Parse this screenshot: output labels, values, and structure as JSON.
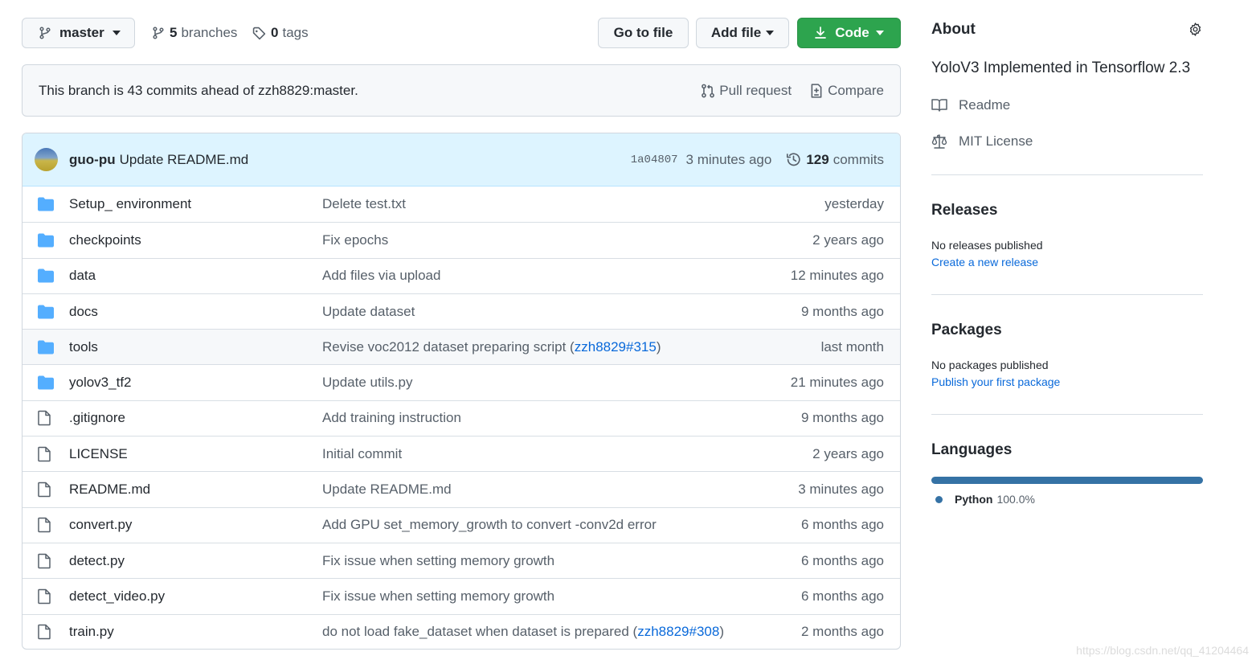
{
  "toolbar": {
    "branch_name": "master",
    "branches_count": "5",
    "branches_label": "branches",
    "tags_count": "0",
    "tags_label": "tags",
    "goto_file_label": "Go to file",
    "add_file_label": "Add file",
    "code_label": "Code"
  },
  "ahead_banner": {
    "text": "This branch is 43 commits ahead of zzh8829:master.",
    "pull_request_label": "Pull request",
    "compare_label": "Compare"
  },
  "latest_commit": {
    "author": "guo-pu",
    "message": "Update README.md",
    "sha": "1a04807",
    "time": "3 minutes ago",
    "commits_count": "129",
    "commits_label": "commits"
  },
  "files": [
    {
      "type": "folder",
      "name": "Setup_ environment",
      "message": "Delete test.txt",
      "ref": "",
      "ref_suffix": "",
      "age": "yesterday"
    },
    {
      "type": "folder",
      "name": "checkpoints",
      "message": "Fix epochs",
      "ref": "",
      "ref_suffix": "",
      "age": "2 years ago"
    },
    {
      "type": "folder",
      "name": "data",
      "message": "Add files via upload",
      "ref": "",
      "ref_suffix": "",
      "age": "12 minutes ago"
    },
    {
      "type": "folder",
      "name": "docs",
      "message": "Update dataset",
      "ref": "",
      "ref_suffix": "",
      "age": "9 months ago"
    },
    {
      "type": "folder",
      "name": "tools",
      "message": "Revise voc2012 dataset preparing script (",
      "ref": "zzh8829#315",
      "ref_suffix": ")",
      "age": "last month"
    },
    {
      "type": "folder",
      "name": "yolov3_tf2",
      "message": "Update utils.py",
      "ref": "",
      "ref_suffix": "",
      "age": "21 minutes ago"
    },
    {
      "type": "file",
      "name": ".gitignore",
      "message": "Add training instruction",
      "ref": "",
      "ref_suffix": "",
      "age": "9 months ago"
    },
    {
      "type": "file",
      "name": "LICENSE",
      "message": "Initial commit",
      "ref": "",
      "ref_suffix": "",
      "age": "2 years ago"
    },
    {
      "type": "file",
      "name": "README.md",
      "message": "Update README.md",
      "ref": "",
      "ref_suffix": "",
      "age": "3 minutes ago"
    },
    {
      "type": "file",
      "name": "convert.py",
      "message": "Add GPU set_memory_growth to convert -conv2d error",
      "ref": "",
      "ref_suffix": "",
      "age": "6 months ago"
    },
    {
      "type": "file",
      "name": "detect.py",
      "message": "Fix issue when setting memory growth",
      "ref": "",
      "ref_suffix": "",
      "age": "6 months ago"
    },
    {
      "type": "file",
      "name": "detect_video.py",
      "message": "Fix issue when setting memory growth",
      "ref": "",
      "ref_suffix": "",
      "age": "6 months ago"
    },
    {
      "type": "file",
      "name": "train.py",
      "message": "do not load fake_dataset when dataset is prepared (",
      "ref": "zzh8829#308",
      "ref_suffix": ")",
      "age": "2 months ago"
    }
  ],
  "sidebar": {
    "about_title": "About",
    "description": "YoloV3 Implemented in Tensorflow 2.3",
    "readme_label": "Readme",
    "license_label": "MIT License",
    "releases_title": "Releases",
    "releases_empty": "No releases published",
    "releases_link": "Create a new release",
    "packages_title": "Packages",
    "packages_empty": "No packages published",
    "packages_link": "Publish your first package",
    "languages_title": "Languages",
    "languages": [
      {
        "name": "Python",
        "percent": "100.0%",
        "color": "#3572a5"
      }
    ]
  },
  "watermark": "https://blog.csdn.net/qq_41204464",
  "colors": {
    "accent_green": "#2da44e",
    "link_blue": "#0969da",
    "folder_blue": "#54aeff",
    "commit_bg": "#ddf4ff"
  }
}
